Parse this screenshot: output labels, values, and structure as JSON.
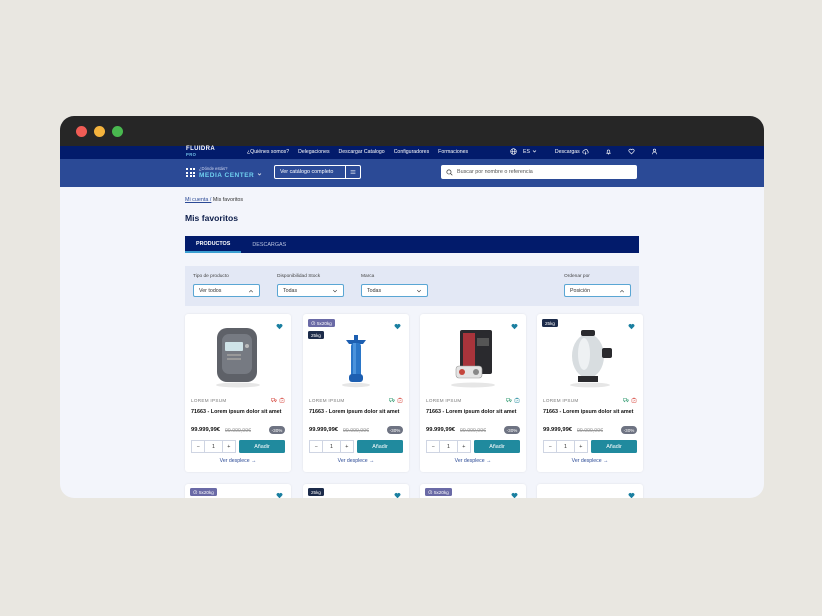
{
  "top_nav": {
    "logo_line1": "FLUIDRA",
    "logo_line2": "PRO",
    "links": [
      "¿Quiénes somos?",
      "Delegaciones",
      "Descargar Catalogo",
      "Configuradores",
      "Formaciones"
    ],
    "language": "ES",
    "downloads": "Descargas"
  },
  "main_bar": {
    "where_label": "¿Dónde estás?",
    "section": "MEDIA CENTER",
    "catalog_button": "Ver catálogo completo",
    "search_placeholder": "Buscar por nombre o referencia"
  },
  "breadcrumb": {
    "parent": "Mi cuenta /",
    "current": "Mis favoritos"
  },
  "page_title": "Mis favoritos",
  "tabs": [
    {
      "label": "PRODUCTOS",
      "active": true
    },
    {
      "label": "DESCARGAS",
      "active": false
    }
  ],
  "filters": {
    "type": {
      "label": "Tipo de producto",
      "value": "Ver todos"
    },
    "stock": {
      "label": "Disponibilidad Stock",
      "value": "Todas"
    },
    "brand": {
      "label": "Marca",
      "value": "Todas"
    },
    "sort": {
      "label": "Ordenar por",
      "value": "Posición"
    }
  },
  "colors": {
    "navy": "#021b6b",
    "blue_bar": "#2b4a96",
    "teal": "#208a9e",
    "heart": "#1a7fa0",
    "badge_purple": "#6a6aa6"
  },
  "products": [
    {
      "badges": [],
      "brand": "LOREM IPSUM",
      "name": "71663 - Lorem ipsum dolor sit amet",
      "price": "99.999,99€",
      "old_price": "99.999,99€",
      "discount": "-30%",
      "qty": "1",
      "add_label": "Añadir",
      "more_label": "Ver desplece",
      "product_icon": "pool-controller-icon",
      "truck_color": "#d6453d",
      "box_color": "#d6453d"
    },
    {
      "badges": [
        "5x20kg",
        "25kg"
      ],
      "brand": "LOREM IPSUM",
      "name": "71663 - Lorem ipsum dolor sit amet",
      "price": "99.999,99€",
      "old_price": "99.999,99€",
      "discount": "-30%",
      "qty": "1",
      "add_label": "Añadir",
      "more_label": "Ver desplece",
      "product_icon": "chlorinator-cell-icon",
      "truck_color": "#2f9a6f",
      "box_color": "#d6453d"
    },
    {
      "badges": [],
      "brand": "LOREM IPSUM",
      "name": "71663 - Lorem ipsum dolor sit amet",
      "price": "99.999,99€",
      "old_price": "99.999,99€",
      "discount": "-30%",
      "qty": "1",
      "add_label": "Añadir",
      "more_label": "Ver desplece",
      "product_icon": "pool-cleaner-box-icon",
      "truck_color": "#2f9a6f",
      "box_color": "#208a9e"
    },
    {
      "badges": [
        "25kg"
      ],
      "brand": "LOREM IPSUM",
      "name": "71663 - Lorem ipsum dolor sit amet",
      "price": "99.999,99€",
      "old_price": "99.999,99€",
      "discount": "-30%",
      "qty": "1",
      "add_label": "Añadir",
      "more_label": "Ver desplece",
      "product_icon": "sand-filter-icon",
      "truck_color": "#2f9a6f",
      "box_color": "#d6453d"
    }
  ],
  "products_row2_badges": [
    "5x20kg",
    "25kg",
    "5x20kg",
    ""
  ]
}
